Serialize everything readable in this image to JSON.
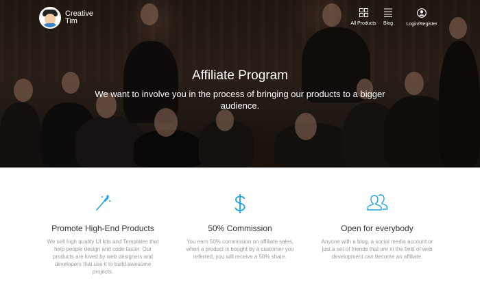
{
  "brand": {
    "name": "Creative Tim"
  },
  "nav": {
    "items": [
      {
        "label": "All Products",
        "icon": "grid-icon"
      },
      {
        "label": "Blog",
        "icon": "list-icon"
      },
      {
        "label": "Login/Register",
        "icon": "user-icon"
      }
    ]
  },
  "hero": {
    "title": "Affiliate Program",
    "subtitle": "We want to involve you in the process of bringing our products to a bigger audience."
  },
  "features": [
    {
      "icon": "magic-wand-icon",
      "title": "Promote High-End Products",
      "text": "We sell high quality UI kits and Templates that help people design and code faster. Our products are loved by web designers and developers that use it to build awesome projects."
    },
    {
      "icon": "dollar-icon",
      "title": "50% Commission",
      "text": "You earn 50% commission on affiliate sales, when a product is bought by a customer you referred, you will receive a 50% share."
    },
    {
      "icon": "users-icon",
      "title": "Open for everybody",
      "text": "Anyone with a blog, a social media account or just a set of friends that are in the field of web development can become an affiliate."
    }
  ],
  "colors": {
    "accent": "#1aa3e8",
    "hero_text": "#ffffff",
    "body_text": "#9a9a9a",
    "heading": "#333333"
  }
}
